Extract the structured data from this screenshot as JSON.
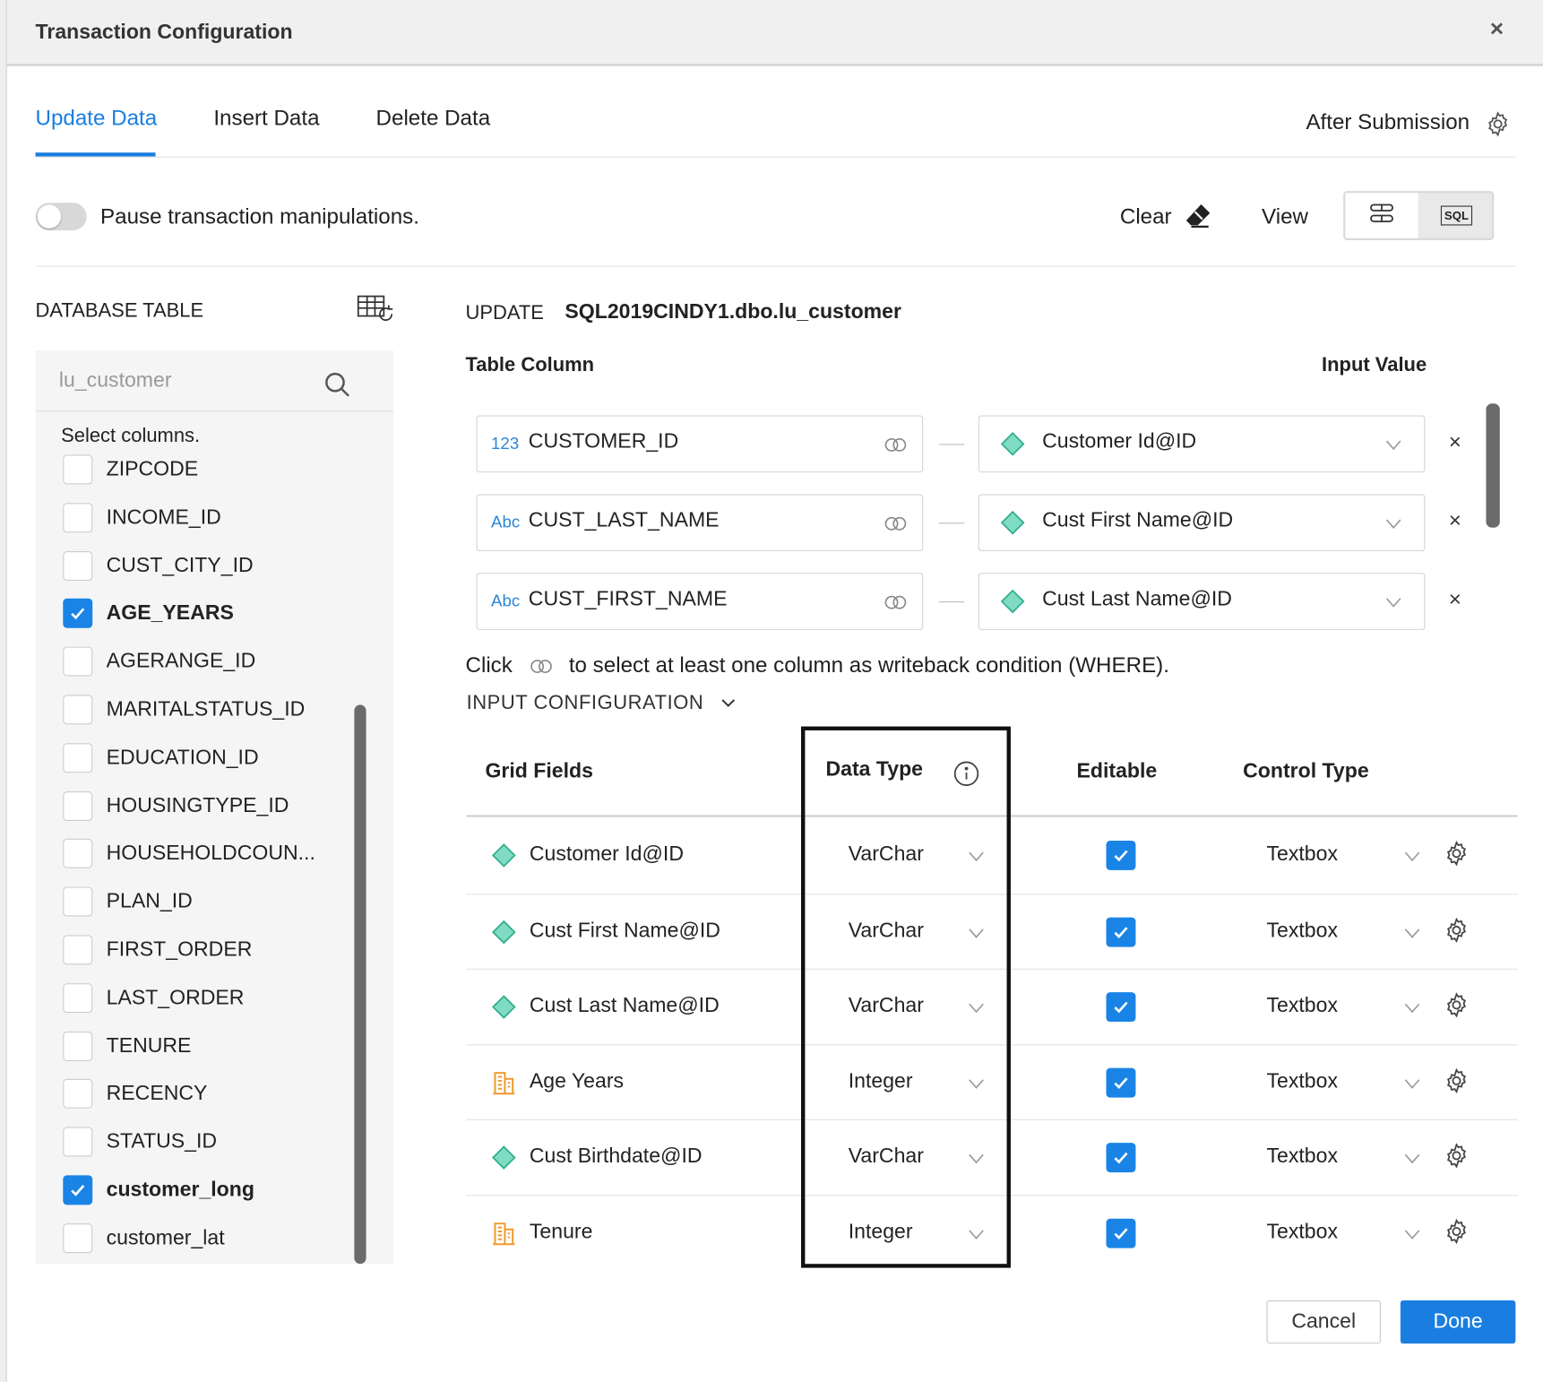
{
  "dialog": {
    "title": "Transaction Configuration",
    "close": "×"
  },
  "tabs": [
    {
      "label": "Update Data",
      "active": true
    },
    {
      "label": "Insert Data",
      "active": false
    },
    {
      "label": "Delete Data",
      "active": false
    }
  ],
  "after_submission": {
    "label": "After Submission",
    "icon": "gear-icon"
  },
  "toolbar": {
    "pause_toggle_on": false,
    "pause_label": "Pause transaction manipulations.",
    "clear_label": "Clear",
    "view_label": "View",
    "view_options": [
      {
        "icon": "grid-view-icon",
        "selected": true
      },
      {
        "icon": "sql-view-icon",
        "text": "SQL",
        "selected": false
      }
    ]
  },
  "database_table": {
    "heading": "DATABASE TABLE",
    "search_value": "lu_customer",
    "select_columns_label": "Select columns.",
    "columns": [
      {
        "name": "ZIPCODE",
        "checked": false
      },
      {
        "name": "INCOME_ID",
        "checked": false
      },
      {
        "name": "CUST_CITY_ID",
        "checked": false
      },
      {
        "name": "AGE_YEARS",
        "checked": true
      },
      {
        "name": "AGERANGE_ID",
        "checked": false
      },
      {
        "name": "MARITALSTATUS_ID",
        "checked": false
      },
      {
        "name": "EDUCATION_ID",
        "checked": false
      },
      {
        "name": "HOUSINGTYPE_ID",
        "checked": false
      },
      {
        "name": "HOUSEHOLDCOUN...",
        "checked": false
      },
      {
        "name": "PLAN_ID",
        "checked": false
      },
      {
        "name": "FIRST_ORDER",
        "checked": false
      },
      {
        "name": "LAST_ORDER",
        "checked": false
      },
      {
        "name": "TENURE",
        "checked": false
      },
      {
        "name": "RECENCY",
        "checked": false
      },
      {
        "name": "STATUS_ID",
        "checked": false
      },
      {
        "name": "customer_long",
        "checked": true
      },
      {
        "name": "customer_lat",
        "checked": false
      }
    ]
  },
  "update": {
    "keyword": "UPDATE",
    "target": "SQL2019CINDY1.dbo.lu_customer",
    "table_column_header": "Table Column",
    "input_value_header": "Input Value",
    "mappings": [
      {
        "type": "123",
        "column": "CUSTOMER_ID",
        "input": "Customer Id@ID"
      },
      {
        "type": "Abc",
        "column": "CUST_LAST_NAME",
        "input": "Cust First Name@ID"
      },
      {
        "type": "Abc",
        "column": "CUST_FIRST_NAME",
        "input": "Cust Last Name@ID"
      }
    ],
    "remove": "×",
    "hint_before": "Click",
    "hint_after": "to select at least one column as writeback condition (WHERE).",
    "input_config_label": "INPUT CONFIGURATION"
  },
  "grid": {
    "headers": {
      "fields": "Grid Fields",
      "data_type": "Data Type",
      "editable": "Editable",
      "control_type": "Control Type"
    },
    "rows": [
      {
        "icon": "attribute-diamond-icon",
        "name": "Customer Id@ID",
        "data_type": "VarChar",
        "editable": true,
        "control": "Textbox"
      },
      {
        "icon": "attribute-diamond-icon",
        "name": "Cust First Name@ID",
        "data_type": "VarChar",
        "editable": true,
        "control": "Textbox"
      },
      {
        "icon": "attribute-diamond-icon",
        "name": "Cust Last Name@ID",
        "data_type": "VarChar",
        "editable": true,
        "control": "Textbox"
      },
      {
        "icon": "metric-building-icon",
        "name": "Age Years",
        "data_type": "Integer",
        "editable": true,
        "control": "Textbox"
      },
      {
        "icon": "attribute-diamond-icon",
        "name": "Cust Birthdate@ID",
        "data_type": "VarChar",
        "editable": true,
        "control": "Textbox"
      },
      {
        "icon": "metric-building-icon",
        "name": "Tenure",
        "data_type": "Integer",
        "editable": true,
        "control": "Textbox"
      }
    ]
  },
  "footer": {
    "cancel": "Cancel",
    "done": "Done"
  },
  "colors": {
    "accent": "#1a7ee0",
    "attribute": "#3dbf9c",
    "metric": "#f0a33a"
  }
}
